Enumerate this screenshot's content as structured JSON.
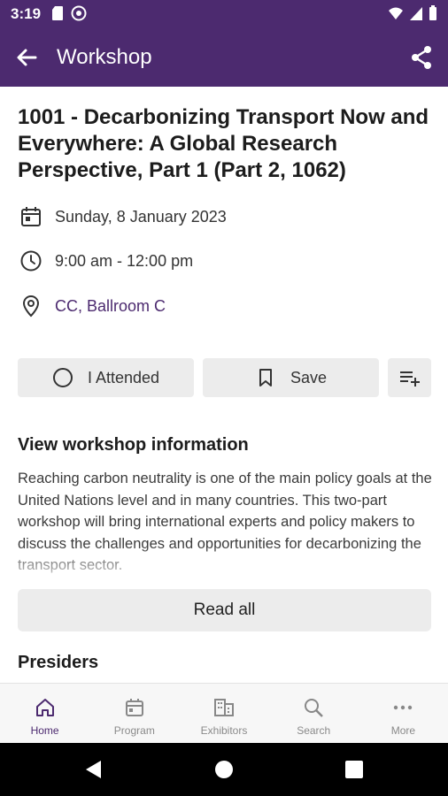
{
  "status_bar": {
    "time": "3:19"
  },
  "app_bar": {
    "title": "Workshop"
  },
  "event": {
    "title": "1001 - Decarbonizing Transport Now and Everywhere: A Global Research Perspective, Part 1 (Part 2, 1062)",
    "date": "Sunday, 8 January 2023",
    "time": "9:00 am - 12:00 pm",
    "location": "CC, Ballroom C"
  },
  "actions": {
    "attended": "I Attended",
    "save": "Save"
  },
  "info_section": {
    "title": "View workshop information",
    "description": "Reaching carbon neutrality is one of the main policy goals at the United Nations level and in many countries. This two-part workshop will bring international experts and policy makers to discuss the challenges and opportunities for decarbonizing the transport sector.",
    "read_all": "Read all"
  },
  "presiders": {
    "title": "Presiders"
  },
  "bottom_nav": [
    {
      "label": "Home",
      "icon": "home-icon",
      "active": true
    },
    {
      "label": "Program",
      "icon": "calendar-icon"
    },
    {
      "label": "Exhibitors",
      "icon": "building-icon"
    },
    {
      "label": "Search",
      "icon": "search-icon"
    },
    {
      "label": "More",
      "icon": "more-dots-icon"
    }
  ],
  "colors": {
    "primary": "#4c2a6f",
    "button_bg": "#ececec",
    "nav_bg": "#f7f7f7"
  }
}
